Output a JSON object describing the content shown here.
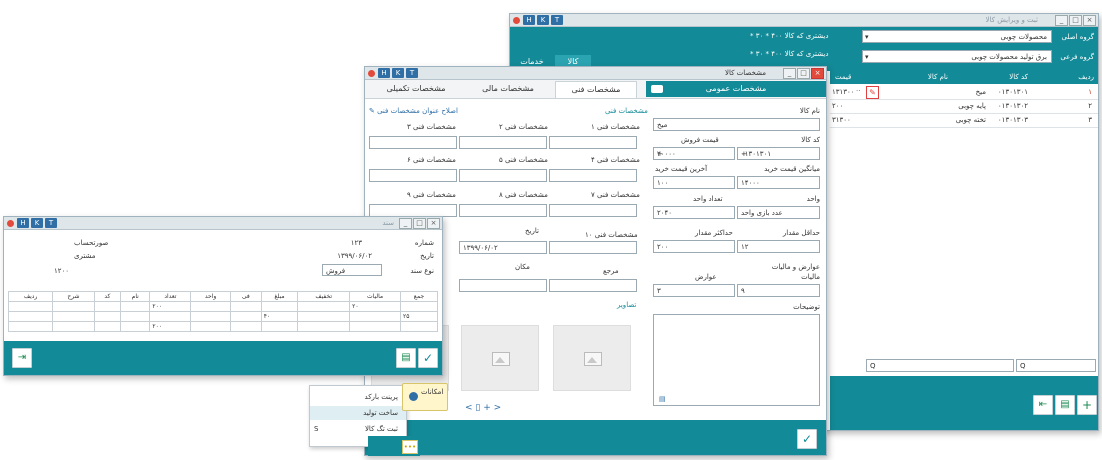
{
  "win_main": {
    "buttons": [
      "H",
      "K",
      "T"
    ],
    "title": "ثبت و ویرایش کالا",
    "group_label": "گروه اصلی",
    "group_value": "محصولات چوبی",
    "subgroup_label": "گروه فرعی",
    "subgroup_value": "برق تولید محصولات چوبی",
    "tab_goods": "کالا",
    "tab_services": "خدمات",
    "info_line1": "* دیشتری که کالا ۴۰۰ * ۳۰",
    "info_line2": "* دیشتری که کالا ۴۰۰ * ۳۰",
    "columns": {
      "row": "ردیف",
      "code": "کد کالا",
      "name": "نام کالا",
      "price": "قیمت"
    },
    "rows": [
      {
        "row": "۱",
        "code": "۰۱۳۰۱۳۰۱",
        "name": "میخ",
        "price": "۱۳۱۳۰۰"
      },
      {
        "row": "۲",
        "code": "۰۱۳۰۱۳۰۲",
        "name": "پایه چوبی",
        "price": "۲۰۰"
      },
      {
        "row": "۳",
        "code": "۰۱۳۰۱۳۰۳",
        "name": "تخته چوبی",
        "price": "۳۱۳۰۰"
      }
    ],
    "filter1": "Q",
    "filter2": "Q"
  },
  "win_detail": {
    "buttons": [
      "H",
      "K",
      "T"
    ],
    "title": "مشخصات کالا",
    "tab_general": "مشخصات عمومی",
    "tab_tech": "مشخصات فنی",
    "tab_other": "مشخصات مالی",
    "tab_extra": "مشخصات تکمیلی",
    "name_label": "نام کالا",
    "name_value": "میخ",
    "code_label": "کد کالا",
    "code_value": "۰۱۳۰۱۳۰۱",
    "sale_label": "قیمت فروش",
    "sale_value": "۲۰۰۰۰",
    "avg_label": "میانگین قیمت خرید",
    "avg_value": "۱۴۰۰۰",
    "last_label": "آخرین قیمت خرید",
    "last_value": "۱۰۰",
    "unit_label": "واحد",
    "unit_value": "عدد بازی واحد",
    "unit2_label": "تعداد واحد",
    "unit2_value": "۲۰۴۰",
    "min_label": "حداقل مقدار",
    "min_value": "۱۲",
    "max_label": "حداکثر مقدار",
    "max_value": "۲۰۰",
    "tax_label": "عوارض و مالیات",
    "tax_sub": "مالیات",
    "tax_value": "۹",
    "duty_label": "عوارض",
    "duty_value": "۳",
    "desc_label": "توضیحات",
    "tech_header": "مشخصات فنی",
    "tech_edit": "اصلاح عنوان مشخصات فنی",
    "tech_labels": [
      "مشخصات فنی ۱",
      "مشخصات فنی ۲",
      "مشخصات فنی ۳",
      "مشخصات فنی ۴",
      "مشخصات فنی ۵",
      "مشخصات فنی ۶",
      "مشخصات فنی ۷",
      "مشخصات فنی ۸",
      "مشخصات فنی ۹",
      "مشخصات فنی ۱۰"
    ],
    "date_label": "تاریخ",
    "date_value": "۱۳۹۹/۰۶/۰۲",
    "place_label": "مکان",
    "ref_label": "مرجع",
    "images_label": "تصاویر",
    "pager": "< ▯ + >"
  },
  "win_small": {
    "buttons": [
      "H",
      "K",
      "T"
    ],
    "title": "سند",
    "field1_label": "شماره",
    "field1_value": "۱۲۳",
    "field2_label": "تاریخ",
    "field2_value": "۱۳۹۹/۰۶/۰۲",
    "field3_label": "نوع سند",
    "field3_value": "فروش",
    "left1": "صورتحساب",
    "left2": "مشتری",
    "left3": "۱۲۰۰",
    "grid_headers": [
      "ردیف",
      "شرح",
      "کد",
      "نام",
      "تعداد",
      "واحد",
      "فی",
      "مبلغ",
      "تخفیف",
      "مالیات",
      "جمع"
    ],
    "grid_rows": [
      [
        "",
        "",
        "",
        "",
        "۲۰۰",
        "",
        "",
        "",
        "",
        "۲۰",
        ""
      ],
      [
        "",
        "",
        "",
        "",
        "",
        "",
        "",
        "۴۰",
        "",
        "",
        "۲۵"
      ],
      [
        "",
        "",
        "",
        "",
        "۲۰۰",
        "",
        "",
        "",
        "",
        "",
        ""
      ]
    ]
  },
  "popup": {
    "title": "امکانات",
    "items": [
      "پرینت بارکد",
      "ساخت تولید",
      "ثبت تگ کالا"
    ],
    "item3_shortcut": "S"
  },
  "colors": {
    "teal": "#138a97",
    "accent": "#2f6fa6"
  }
}
